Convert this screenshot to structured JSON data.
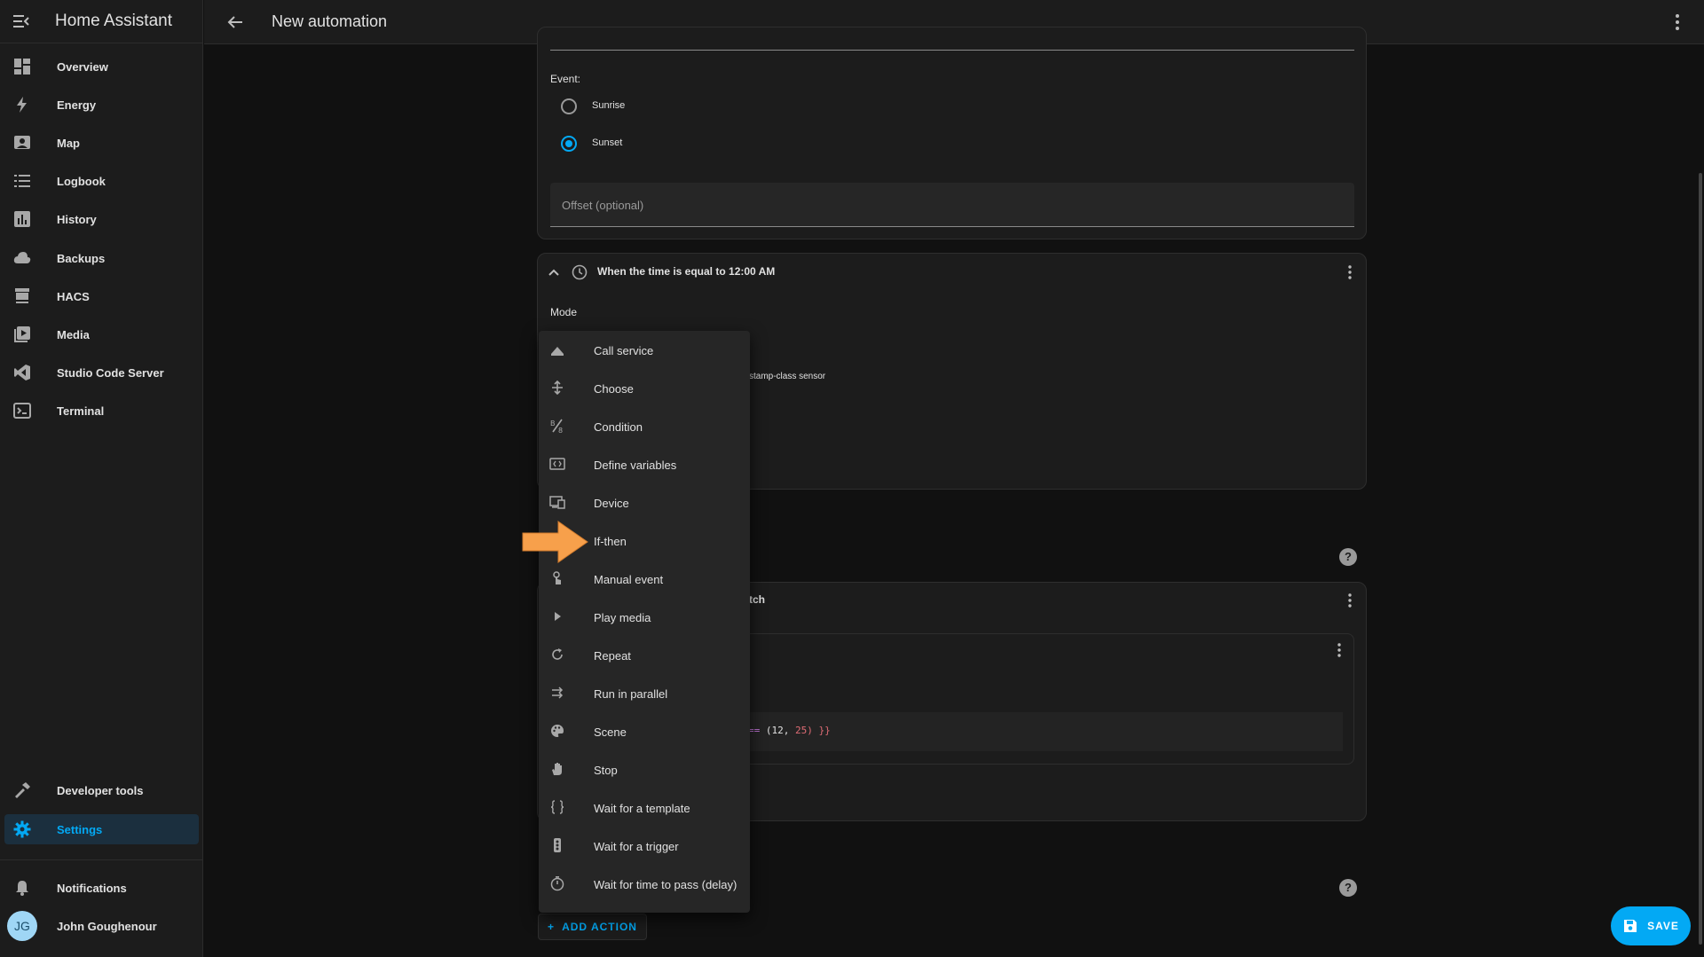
{
  "app": {
    "title": "Home Assistant"
  },
  "header": {
    "title": "New automation"
  },
  "sidebar": {
    "items": [
      {
        "label": "Overview",
        "icon": "overview-grid-icon"
      },
      {
        "label": "Energy",
        "icon": "lightning-icon"
      },
      {
        "label": "Map",
        "icon": "map-account-icon"
      },
      {
        "label": "Logbook",
        "icon": "list-icon"
      },
      {
        "label": "History",
        "icon": "chart-icon"
      },
      {
        "label": "Backups",
        "icon": "cloud-icon"
      },
      {
        "label": "HACS",
        "icon": "hacs-store-icon"
      },
      {
        "label": "Media",
        "icon": "media-play-icon"
      },
      {
        "label": "Studio Code Server",
        "icon": "vscode-icon"
      },
      {
        "label": "Terminal",
        "icon": "terminal-icon"
      }
    ],
    "bottom": [
      {
        "label": "Developer tools",
        "icon": "hammer-icon"
      },
      {
        "label": "Settings",
        "icon": "gear-icon",
        "active": true
      }
    ],
    "notifications": "Notifications",
    "user": {
      "name": "John Goughenour",
      "initials": "JG"
    }
  },
  "trigger_sun": {
    "event_label": "Event:",
    "options": [
      {
        "label": "Sunrise",
        "selected": false
      },
      {
        "label": "Sunset",
        "selected": true
      }
    ],
    "offset_placeholder": "Offset (optional)"
  },
  "trigger_time": {
    "title": "When the time is equal to 12:00 AM",
    "mode_label": "Mode",
    "partial_text": "stamp-class sensor"
  },
  "action_card": {
    "partial_title": "tch",
    "code_left": "==",
    "code_mid": "(12,",
    "code_num": "25",
    "code_right": ") }}"
  },
  "action_menu": {
    "items": [
      {
        "label": "Call service",
        "icon": "call-service-icon"
      },
      {
        "label": "Choose",
        "icon": "choose-icon"
      },
      {
        "label": "Condition",
        "icon": "condition-icon"
      },
      {
        "label": "Define variables",
        "icon": "variables-icon"
      },
      {
        "label": "Device",
        "icon": "device-icon"
      },
      {
        "label": "If-then",
        "icon": "if-then-icon"
      },
      {
        "label": "Manual event",
        "icon": "manual-event-icon"
      },
      {
        "label": "Play media",
        "icon": "play-icon"
      },
      {
        "label": "Repeat",
        "icon": "repeat-icon"
      },
      {
        "label": "Run in parallel",
        "icon": "parallel-icon"
      },
      {
        "label": "Scene",
        "icon": "palette-icon"
      },
      {
        "label": "Stop",
        "icon": "hand-icon"
      },
      {
        "label": "Wait for a template",
        "icon": "braces-icon"
      },
      {
        "label": "Wait for a trigger",
        "icon": "traffic-light-icon"
      },
      {
        "label": "Wait for time to pass (delay)",
        "icon": "timer-icon"
      }
    ]
  },
  "buttons": {
    "add_action": "ADD ACTION",
    "save": "SAVE"
  },
  "colors": {
    "accent": "#03a9f4",
    "arrow": "#f7a04b",
    "background": "#111111",
    "card": "#1c1c1c"
  }
}
